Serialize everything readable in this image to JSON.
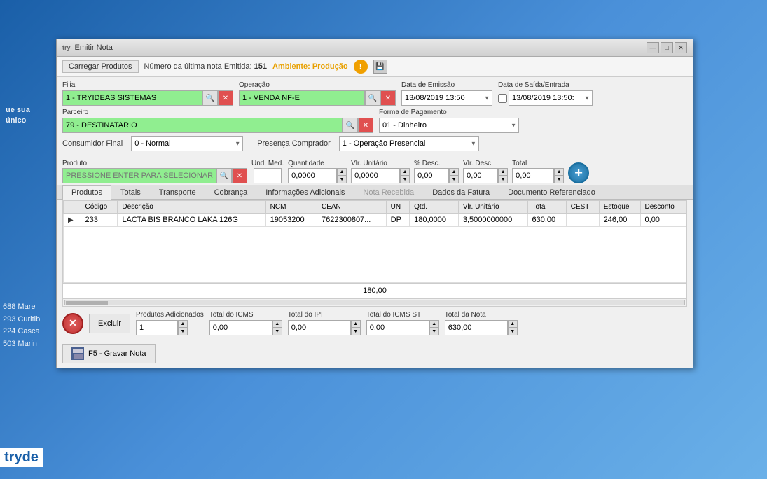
{
  "window": {
    "title_prefix": "try",
    "title": "Emitir Nota",
    "minimize": "—",
    "maximize": "□",
    "close": "✕"
  },
  "toolbar": {
    "load_products": "Carregar Produtos",
    "last_note_label": "Número da última nota Emitida:",
    "last_note_number": "151",
    "env_label": "Ambiente: Produção",
    "warning_icon": "!",
    "disk_icon": "💾"
  },
  "form": {
    "filial_label": "Filial",
    "filial_value": "1 - TRYIDEAS SISTEMAS",
    "operacao_label": "Operação",
    "operacao_value": "1 - VENDA NF-E",
    "data_emissao_label": "Data de Emissão",
    "data_emissao_value": "13/08/2019 13:50",
    "data_saida_label": "Data de Saída/Entrada",
    "data_saida_value": "13/08/2019 13:50:",
    "parceiro_label": "Parceiro",
    "parceiro_value": "79 - DESTINATARIO",
    "forma_pagamento_label": "Forma de Pagamento",
    "forma_pagamento_value": "01 - Dinheiro",
    "consumidor_label": "Consumidor Final",
    "consumidor_value": "0 - Normal",
    "presenca_label": "Presença Comprador",
    "presenca_value": "1 - Operação Presencial"
  },
  "product_section": {
    "produto_label": "Produto",
    "produto_placeholder": "PRESSIONE ENTER PARA SELECIONAR O PRODUTO",
    "und_med_label": "Und. Med.",
    "quantidade_label": "Quantidade",
    "quantidade_value": "0,0000",
    "vlr_unitario_label": "Vlr. Unitário",
    "vlr_unitario_value": "0,0000",
    "pct_desc_label": "% Desc.",
    "pct_desc_value": "0,00",
    "vlr_desc_label": "Vlr. Desc",
    "vlr_desc_value": "0,00",
    "total_label": "Total",
    "total_value": "0,00"
  },
  "tabs": [
    {
      "label": "Produtos",
      "active": true,
      "disabled": false
    },
    {
      "label": "Totais",
      "active": false,
      "disabled": false
    },
    {
      "label": "Transporte",
      "active": false,
      "disabled": false
    },
    {
      "label": "Cobrança",
      "active": false,
      "disabled": false
    },
    {
      "label": "Informações Adicionais",
      "active": false,
      "disabled": false
    },
    {
      "label": "Nota Recebida",
      "active": false,
      "disabled": true
    },
    {
      "label": "Dados da Fatura",
      "active": false,
      "disabled": false
    },
    {
      "label": "Documento Referenciado",
      "active": false,
      "disabled": false
    }
  ],
  "table": {
    "columns": [
      "Código",
      "Descrição",
      "NCM",
      "CEAN",
      "UN",
      "Qtd.",
      "Vlr. Unitário",
      "Total",
      "CEST",
      "Estoque",
      "Desconto"
    ],
    "rows": [
      {
        "arrow": "▶",
        "codigo": "233",
        "descricao": "LACTA BIS BRANCO LAKA 126G",
        "ncm": "19053200",
        "cean": "7622300807...",
        "un": "DP",
        "qtd": "180,0000",
        "vlr_unitario": "3,5000000000",
        "total": "630,00",
        "cest": "",
        "estoque": "246,00",
        "desconto": "0,00"
      }
    ],
    "subtotal": "180,00"
  },
  "footer": {
    "excluir_label": "Excluir",
    "produtos_adicionados_label": "Produtos Adicionados",
    "produtos_adicionados_value": "1",
    "total_icms_label": "Total do ICMS",
    "total_icms_value": "0,00",
    "total_ipi_label": "Total do IPI",
    "total_ipi_value": "0,00",
    "total_icms_st_label": "Total do ICMS ST",
    "total_icms_st_value": "0,00",
    "total_nota_label": "Total da Nota",
    "total_nota_value": "630,00"
  },
  "save_button": {
    "label": "F5 - Gravar Nota"
  }
}
